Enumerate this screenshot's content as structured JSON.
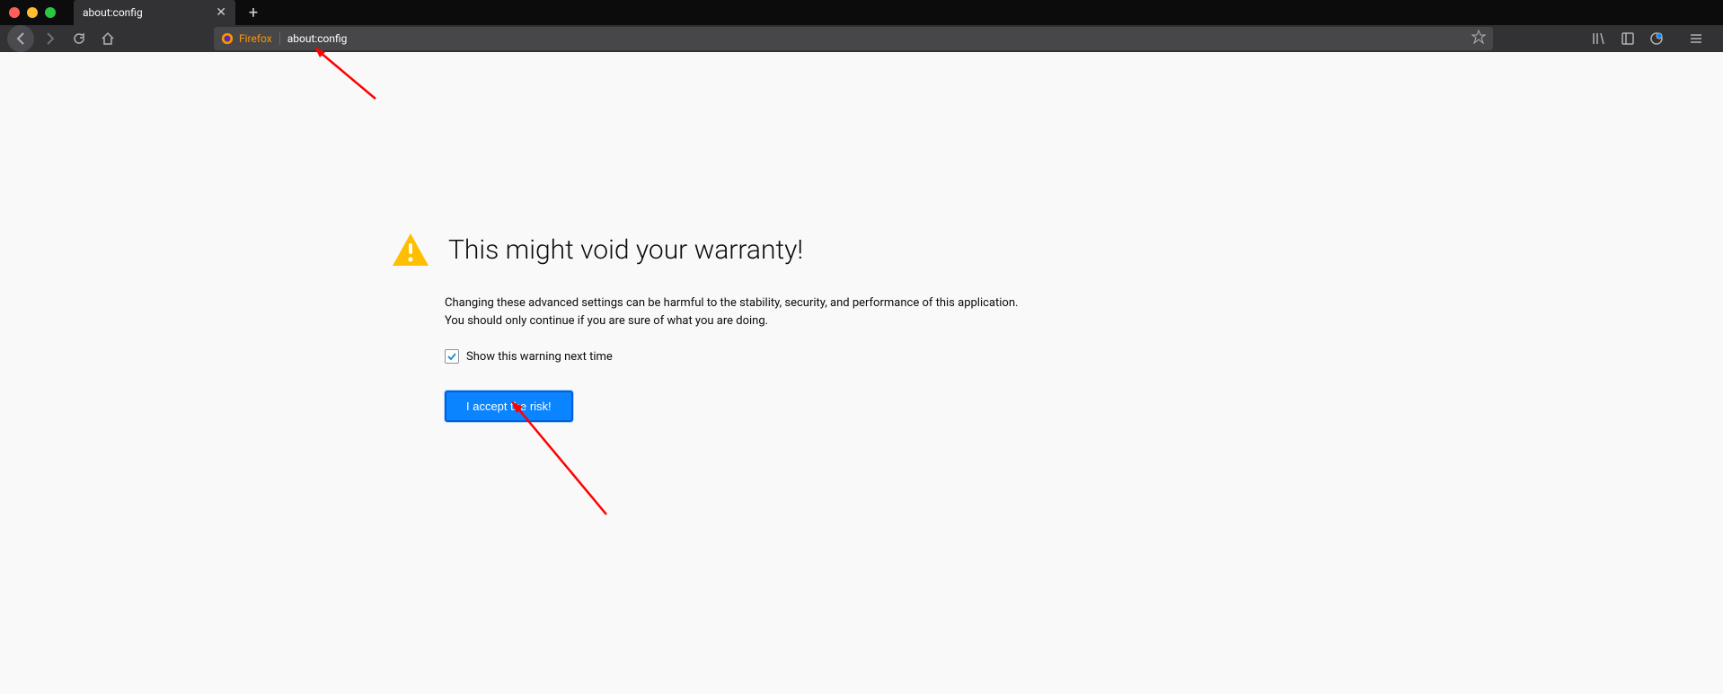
{
  "window": {
    "tab_title": "about:config"
  },
  "urlbar": {
    "identity_label": "Firefox",
    "url": "about:config"
  },
  "warning": {
    "title": "This might void your warranty!",
    "body": "Changing these advanced settings can be harmful to the stability, security, and performance of this application. You should only continue if you are sure of what you are doing.",
    "checkbox_label": "Show this warning next time",
    "accept_label": "I accept the risk!"
  }
}
